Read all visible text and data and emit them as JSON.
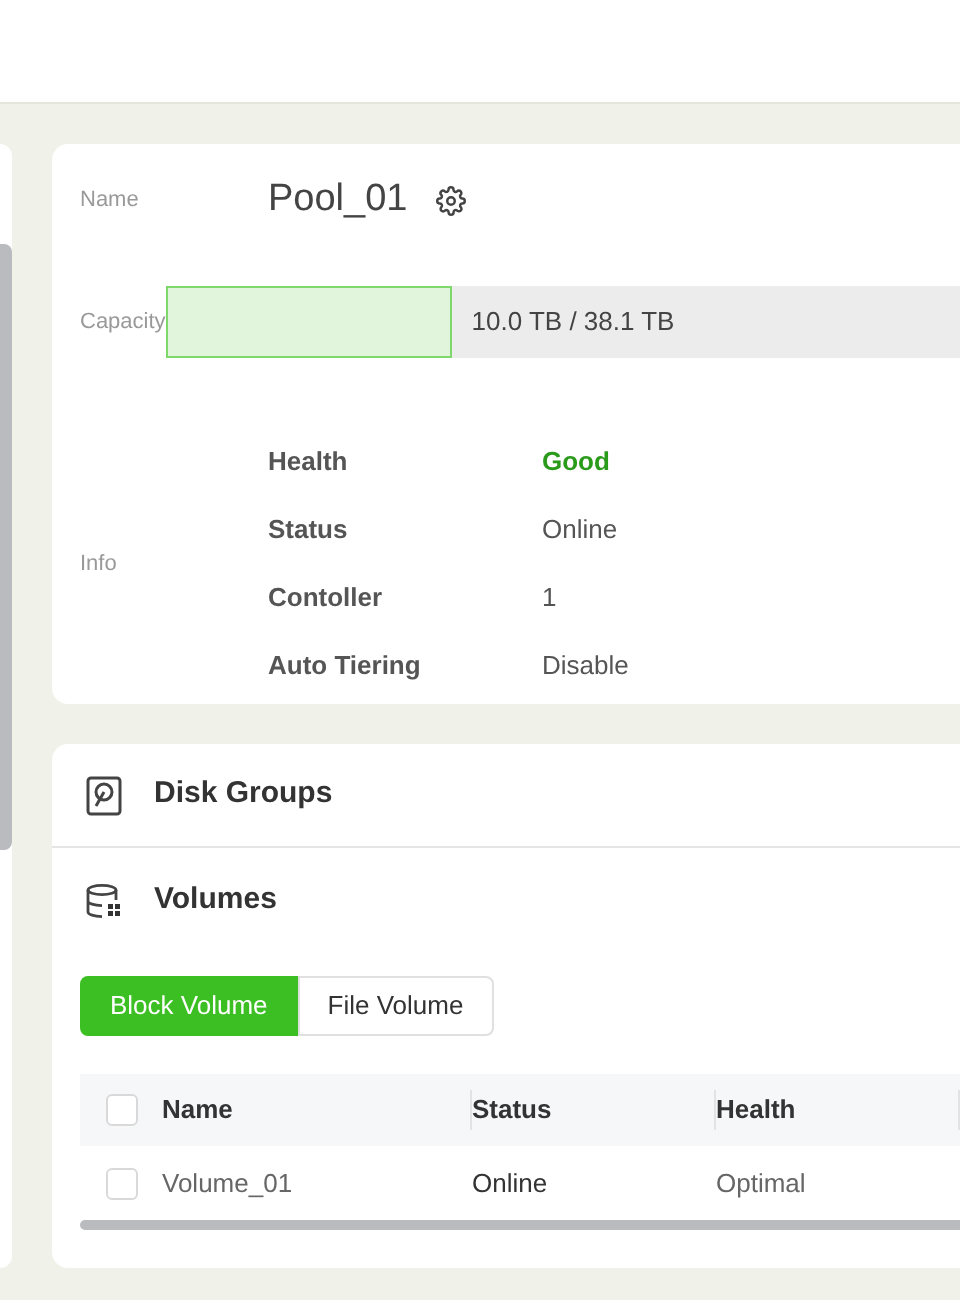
{
  "pool": {
    "name_label": "Name",
    "name": "Pool_01",
    "capacity_label": "Capacity",
    "capacity": {
      "level": 0.26,
      "reading": "10.0 TB / 38.1 TB"
    },
    "info_label": "Info",
    "info": [
      {
        "label": "Health",
        "value": "Good",
        "kind": "good"
      },
      {
        "label": "Status",
        "value": "Online",
        "kind": "plain"
      },
      {
        "label": "Contoller",
        "value": "1",
        "kind": "plain"
      },
      {
        "label": "Auto Tiering",
        "value": "Disable",
        "kind": "plain"
      }
    ]
  },
  "sections": [
    {
      "title": "Disk Groups",
      "kind": "disk"
    },
    {
      "title": "Volumes",
      "kind": "volumes"
    }
  ],
  "volume_tabs": [
    {
      "label": "Block Volume",
      "selected": true
    },
    {
      "label": "File Volume",
      "selected": false
    }
  ],
  "table": {
    "columns": [
      "Name",
      "Status",
      "Health"
    ],
    "header_checked": false,
    "rows": [
      {
        "checked": false,
        "cells": [
          "Volume_01",
          "Online",
          "Optimal"
        ]
      }
    ]
  }
}
